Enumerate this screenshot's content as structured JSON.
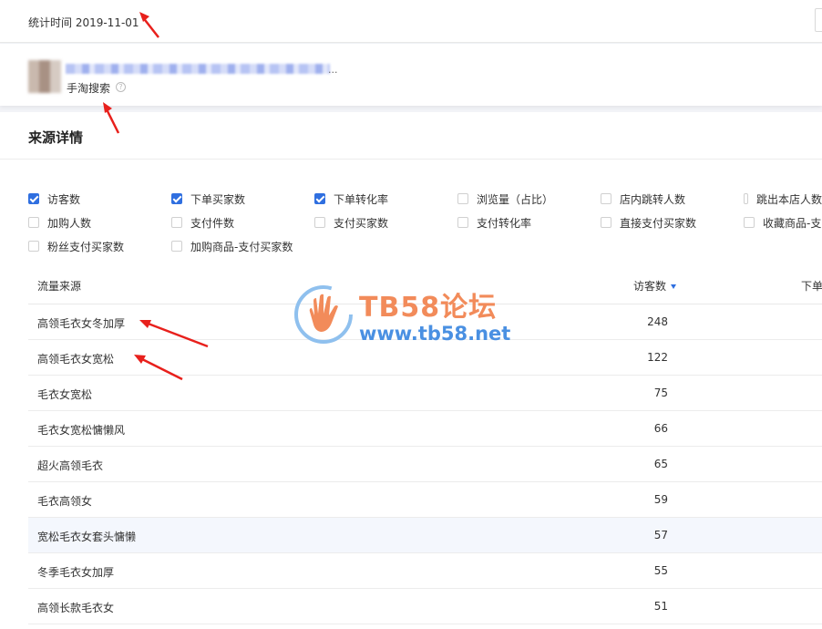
{
  "header": {
    "stat_time": "统计时间 2019-11-01"
  },
  "item": {
    "ellipsis": "...",
    "source": "手淘搜索",
    "help": "?"
  },
  "panel": {
    "title": "来源详情"
  },
  "metrics": [
    {
      "label": "访客数",
      "checked": true
    },
    {
      "label": "下单买家数",
      "checked": true
    },
    {
      "label": "下单转化率",
      "checked": true
    },
    {
      "label": "浏览量（占比）",
      "checked": false
    },
    {
      "label": "店内跳转人数",
      "checked": false
    },
    {
      "label": "跳出本店人数",
      "checked": false
    },
    {
      "label": "加购人数",
      "checked": false
    },
    {
      "label": "支付件数",
      "checked": false
    },
    {
      "label": "支付买家数",
      "checked": false
    },
    {
      "label": "支付转化率",
      "checked": false
    },
    {
      "label": "直接支付买家数",
      "checked": false
    },
    {
      "label": "收藏商品-支",
      "checked": false
    },
    {
      "label": "粉丝支付买家数",
      "checked": false
    },
    {
      "label": "加购商品-支付买家数",
      "checked": false
    }
  ],
  "table": {
    "headers": {
      "source": "流量来源",
      "visitors": "访客数",
      "orders": "下单"
    },
    "rows": [
      {
        "keyword": "高领毛衣女冬加厚",
        "visitors": "248"
      },
      {
        "keyword": "高领毛衣女宽松",
        "visitors": "122"
      },
      {
        "keyword": "毛衣女宽松",
        "visitors": "75"
      },
      {
        "keyword": "毛衣女宽松慵懒风",
        "visitors": "66"
      },
      {
        "keyword": "超火高领毛衣",
        "visitors": "65"
      },
      {
        "keyword": "毛衣高领女",
        "visitors": "59"
      },
      {
        "keyword": "宽松毛衣女套头慵懒",
        "visitors": "57"
      },
      {
        "keyword": "冬季毛衣女加厚",
        "visitors": "55"
      },
      {
        "keyword": "高领长款毛衣女",
        "visitors": "51"
      }
    ]
  },
  "watermark": {
    "title": "TB58论坛",
    "url": "www.tb58.net"
  },
  "colors": {
    "accent": "#2f6fe0",
    "annotation_arrow": "#e8201c",
    "watermark_orange": "#f28b5a",
    "watermark_blue": "#4a90e2"
  }
}
